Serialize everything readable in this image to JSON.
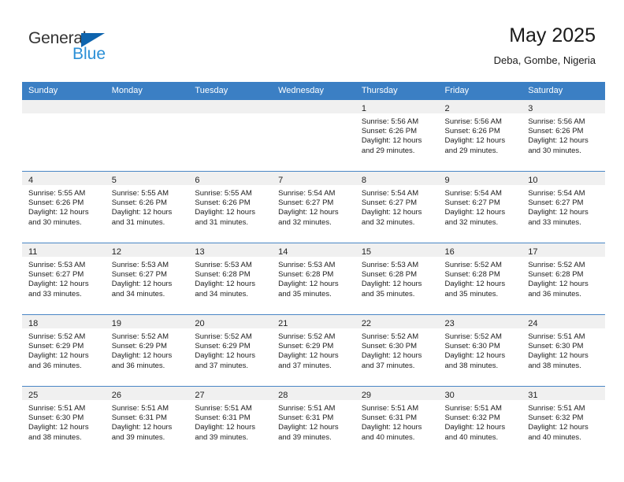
{
  "brand": {
    "name_part1": "General",
    "name_part2": "Blue",
    "triangle_icon": "triangle-icon",
    "color_dark": "#333333",
    "color_blue": "#2b8fd6",
    "color_triangle": "#0e64ae"
  },
  "header": {
    "title": "May 2025",
    "subtitle": "Deba, Gombe, Nigeria"
  },
  "theme": {
    "header_blue": "#3b7fc4",
    "row_divider": "#4a86c5",
    "date_band_gray": "#f0f0f0"
  },
  "weekday_headers": [
    "Sunday",
    "Monday",
    "Tuesday",
    "Wednesday",
    "Thursday",
    "Friday",
    "Saturday"
  ],
  "weeks": [
    [
      {
        "day": "",
        "lines": []
      },
      {
        "day": "",
        "lines": []
      },
      {
        "day": "",
        "lines": []
      },
      {
        "day": "",
        "lines": []
      },
      {
        "day": "1",
        "lines": [
          "Sunrise: 5:56 AM",
          "Sunset: 6:26 PM",
          "Daylight: 12 hours",
          "and 29 minutes."
        ]
      },
      {
        "day": "2",
        "lines": [
          "Sunrise: 5:56 AM",
          "Sunset: 6:26 PM",
          "Daylight: 12 hours",
          "and 29 minutes."
        ]
      },
      {
        "day": "3",
        "lines": [
          "Sunrise: 5:56 AM",
          "Sunset: 6:26 PM",
          "Daylight: 12 hours",
          "and 30 minutes."
        ]
      }
    ],
    [
      {
        "day": "4",
        "lines": [
          "Sunrise: 5:55 AM",
          "Sunset: 6:26 PM",
          "Daylight: 12 hours",
          "and 30 minutes."
        ]
      },
      {
        "day": "5",
        "lines": [
          "Sunrise: 5:55 AM",
          "Sunset: 6:26 PM",
          "Daylight: 12 hours",
          "and 31 minutes."
        ]
      },
      {
        "day": "6",
        "lines": [
          "Sunrise: 5:55 AM",
          "Sunset: 6:26 PM",
          "Daylight: 12 hours",
          "and 31 minutes."
        ]
      },
      {
        "day": "7",
        "lines": [
          "Sunrise: 5:54 AM",
          "Sunset: 6:27 PM",
          "Daylight: 12 hours",
          "and 32 minutes."
        ]
      },
      {
        "day": "8",
        "lines": [
          "Sunrise: 5:54 AM",
          "Sunset: 6:27 PM",
          "Daylight: 12 hours",
          "and 32 minutes."
        ]
      },
      {
        "day": "9",
        "lines": [
          "Sunrise: 5:54 AM",
          "Sunset: 6:27 PM",
          "Daylight: 12 hours",
          "and 32 minutes."
        ]
      },
      {
        "day": "10",
        "lines": [
          "Sunrise: 5:54 AM",
          "Sunset: 6:27 PM",
          "Daylight: 12 hours",
          "and 33 minutes."
        ]
      }
    ],
    [
      {
        "day": "11",
        "lines": [
          "Sunrise: 5:53 AM",
          "Sunset: 6:27 PM",
          "Daylight: 12 hours",
          "and 33 minutes."
        ]
      },
      {
        "day": "12",
        "lines": [
          "Sunrise: 5:53 AM",
          "Sunset: 6:27 PM",
          "Daylight: 12 hours",
          "and 34 minutes."
        ]
      },
      {
        "day": "13",
        "lines": [
          "Sunrise: 5:53 AM",
          "Sunset: 6:28 PM",
          "Daylight: 12 hours",
          "and 34 minutes."
        ]
      },
      {
        "day": "14",
        "lines": [
          "Sunrise: 5:53 AM",
          "Sunset: 6:28 PM",
          "Daylight: 12 hours",
          "and 35 minutes."
        ]
      },
      {
        "day": "15",
        "lines": [
          "Sunrise: 5:53 AM",
          "Sunset: 6:28 PM",
          "Daylight: 12 hours",
          "and 35 minutes."
        ]
      },
      {
        "day": "16",
        "lines": [
          "Sunrise: 5:52 AM",
          "Sunset: 6:28 PM",
          "Daylight: 12 hours",
          "and 35 minutes."
        ]
      },
      {
        "day": "17",
        "lines": [
          "Sunrise: 5:52 AM",
          "Sunset: 6:28 PM",
          "Daylight: 12 hours",
          "and 36 minutes."
        ]
      }
    ],
    [
      {
        "day": "18",
        "lines": [
          "Sunrise: 5:52 AM",
          "Sunset: 6:29 PM",
          "Daylight: 12 hours",
          "and 36 minutes."
        ]
      },
      {
        "day": "19",
        "lines": [
          "Sunrise: 5:52 AM",
          "Sunset: 6:29 PM",
          "Daylight: 12 hours",
          "and 36 minutes."
        ]
      },
      {
        "day": "20",
        "lines": [
          "Sunrise: 5:52 AM",
          "Sunset: 6:29 PM",
          "Daylight: 12 hours",
          "and 37 minutes."
        ]
      },
      {
        "day": "21",
        "lines": [
          "Sunrise: 5:52 AM",
          "Sunset: 6:29 PM",
          "Daylight: 12 hours",
          "and 37 minutes."
        ]
      },
      {
        "day": "22",
        "lines": [
          "Sunrise: 5:52 AM",
          "Sunset: 6:30 PM",
          "Daylight: 12 hours",
          "and 37 minutes."
        ]
      },
      {
        "day": "23",
        "lines": [
          "Sunrise: 5:52 AM",
          "Sunset: 6:30 PM",
          "Daylight: 12 hours",
          "and 38 minutes."
        ]
      },
      {
        "day": "24",
        "lines": [
          "Sunrise: 5:51 AM",
          "Sunset: 6:30 PM",
          "Daylight: 12 hours",
          "and 38 minutes."
        ]
      }
    ],
    [
      {
        "day": "25",
        "lines": [
          "Sunrise: 5:51 AM",
          "Sunset: 6:30 PM",
          "Daylight: 12 hours",
          "and 38 minutes."
        ]
      },
      {
        "day": "26",
        "lines": [
          "Sunrise: 5:51 AM",
          "Sunset: 6:31 PM",
          "Daylight: 12 hours",
          "and 39 minutes."
        ]
      },
      {
        "day": "27",
        "lines": [
          "Sunrise: 5:51 AM",
          "Sunset: 6:31 PM",
          "Daylight: 12 hours",
          "and 39 minutes."
        ]
      },
      {
        "day": "28",
        "lines": [
          "Sunrise: 5:51 AM",
          "Sunset: 6:31 PM",
          "Daylight: 12 hours",
          "and 39 minutes."
        ]
      },
      {
        "day": "29",
        "lines": [
          "Sunrise: 5:51 AM",
          "Sunset: 6:31 PM",
          "Daylight: 12 hours",
          "and 40 minutes."
        ]
      },
      {
        "day": "30",
        "lines": [
          "Sunrise: 5:51 AM",
          "Sunset: 6:32 PM",
          "Daylight: 12 hours",
          "and 40 minutes."
        ]
      },
      {
        "day": "31",
        "lines": [
          "Sunrise: 5:51 AM",
          "Sunset: 6:32 PM",
          "Daylight: 12 hours",
          "and 40 minutes."
        ]
      }
    ]
  ]
}
